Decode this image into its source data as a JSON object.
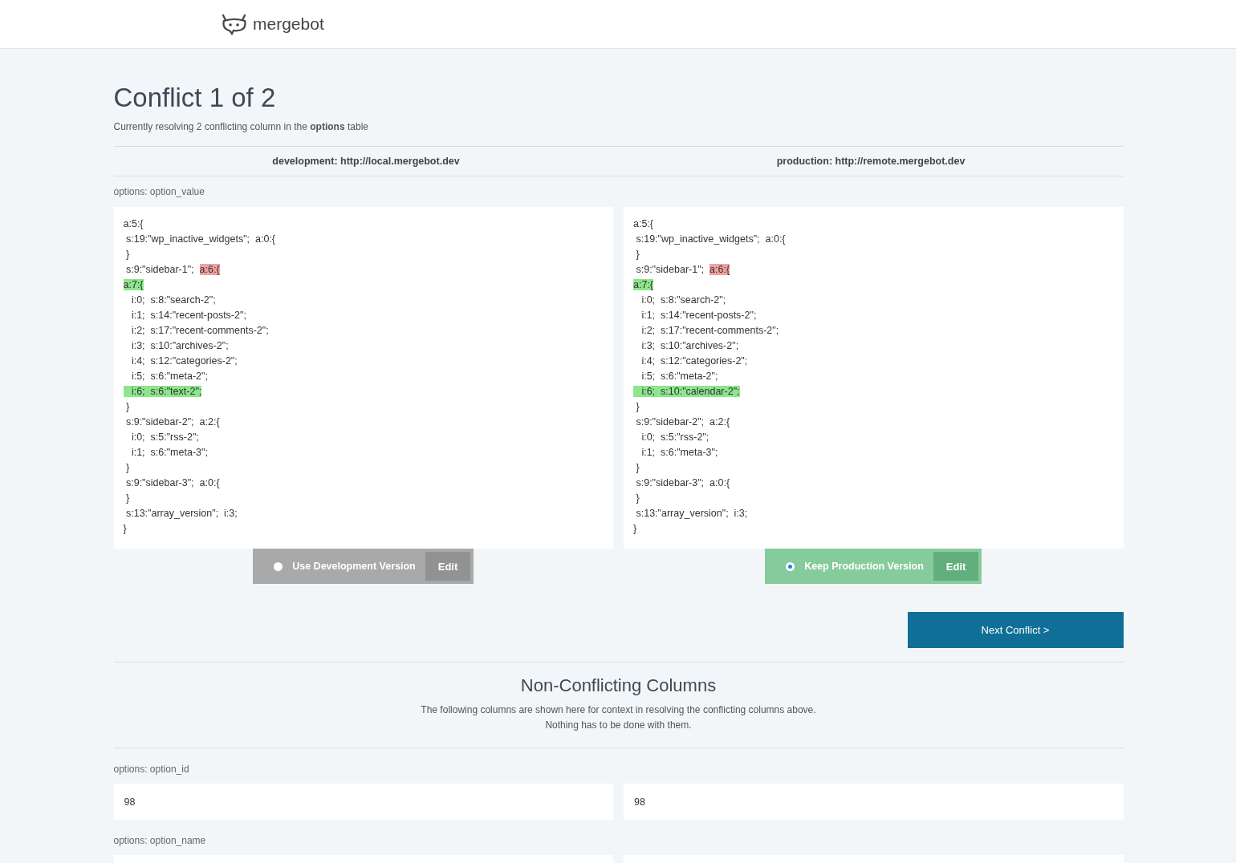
{
  "header": {
    "logo_text": "mergebot"
  },
  "title": "Conflict 1 of 2",
  "subtitle": "Currently resolving 2 conflicting column in the **options** table",
  "environments": [
    "development: http://local.mergebot.dev",
    "production: http://remote.mergebot.dev"
  ],
  "conflict": {
    "label": "options: option_value",
    "versions": [
      {
        "lines": [
          [
            {
              "text": "a:5:{",
              "kind": "plain"
            }
          ],
          [
            {
              "text": " s:19:\"wp_inactive_widgets\";  a:0:{",
              "kind": "plain"
            }
          ],
          [
            {
              "text": " }",
              "kind": "plain"
            }
          ],
          [
            {
              "text": " s:9:\"sidebar-1\";  ",
              "kind": "plain"
            },
            {
              "text": "a:6:{",
              "kind": "removed"
            }
          ],
          [
            {
              "text": "a:7:{",
              "kind": "added"
            }
          ],
          [
            {
              "text": "   i:0;  s:8:\"search-2\";",
              "kind": "plain"
            }
          ],
          [
            {
              "text": "   i:1;  s:14:\"recent-posts-2\";",
              "kind": "plain"
            }
          ],
          [
            {
              "text": "   i:2;  s:17:\"recent-comments-2\";",
              "kind": "plain"
            }
          ],
          [
            {
              "text": "   i:3;  s:10:\"archives-2\";",
              "kind": "plain"
            }
          ],
          [
            {
              "text": "   i:4;  s:12:\"categories-2\";",
              "kind": "plain"
            }
          ],
          [
            {
              "text": "   i:5;  s:6:\"meta-2\";",
              "kind": "plain"
            }
          ],
          [
            {
              "text": "   i:6;  s:6:\"text-2\";",
              "kind": "added"
            }
          ],
          [
            {
              "text": " }",
              "kind": "plain"
            }
          ],
          [
            {
              "text": " s:9:\"sidebar-2\";  a:2:{",
              "kind": "plain"
            }
          ],
          [
            {
              "text": "   i:0;  s:5:\"rss-2\";",
              "kind": "plain"
            }
          ],
          [
            {
              "text": "   i:1;  s:6:\"meta-3\";",
              "kind": "plain"
            }
          ],
          [
            {
              "text": " }",
              "kind": "plain"
            }
          ],
          [
            {
              "text": " s:9:\"sidebar-3\";  a:0:{",
              "kind": "plain"
            }
          ],
          [
            {
              "text": " }",
              "kind": "plain"
            }
          ],
          [
            {
              "text": " s:13:\"array_version\";  i:3;",
              "kind": "plain"
            }
          ],
          [
            {
              "text": "}",
              "kind": "plain"
            }
          ]
        ],
        "choice": {
          "label": "Use Development Version",
          "selected": false
        },
        "edit": "Edit"
      },
      {
        "lines": [
          [
            {
              "text": "a:5:{",
              "kind": "plain"
            }
          ],
          [
            {
              "text": " s:19:\"wp_inactive_widgets\";  a:0:{",
              "kind": "plain"
            }
          ],
          [
            {
              "text": " }",
              "kind": "plain"
            }
          ],
          [
            {
              "text": " s:9:\"sidebar-1\";  ",
              "kind": "plain"
            },
            {
              "text": "a:6:{",
              "kind": "removed"
            }
          ],
          [
            {
              "text": "a:7:{",
              "kind": "added"
            }
          ],
          [
            {
              "text": "   i:0;  s:8:\"search-2\";",
              "kind": "plain"
            }
          ],
          [
            {
              "text": "   i:1;  s:14:\"recent-posts-2\";",
              "kind": "plain"
            }
          ],
          [
            {
              "text": "   i:2;  s:17:\"recent-comments-2\";",
              "kind": "plain"
            }
          ],
          [
            {
              "text": "   i:3;  s:10:\"archives-2\";",
              "kind": "plain"
            }
          ],
          [
            {
              "text": "   i:4;  s:12:\"categories-2\";",
              "kind": "plain"
            }
          ],
          [
            {
              "text": "   i:5;  s:6:\"meta-2\";",
              "kind": "plain"
            }
          ],
          [
            {
              "text": "   i:6;  s:10:\"calendar-2\";",
              "kind": "added"
            }
          ],
          [
            {
              "text": " }",
              "kind": "plain"
            }
          ],
          [
            {
              "text": " s:9:\"sidebar-2\";  a:2:{",
              "kind": "plain"
            }
          ],
          [
            {
              "text": "   i:0;  s:5:\"rss-2\";",
              "kind": "plain"
            }
          ],
          [
            {
              "text": "   i:1;  s:6:\"meta-3\";",
              "kind": "plain"
            }
          ],
          [
            {
              "text": " }",
              "kind": "plain"
            }
          ],
          [
            {
              "text": " s:9:\"sidebar-3\";  a:0:{",
              "kind": "plain"
            }
          ],
          [
            {
              "text": " }",
              "kind": "plain"
            }
          ],
          [
            {
              "text": " s:13:\"array_version\";  i:3;",
              "kind": "plain"
            }
          ],
          [
            {
              "text": "}",
              "kind": "plain"
            }
          ]
        ],
        "choice": {
          "label": "Keep Production Version",
          "selected": true
        },
        "edit": "Edit"
      }
    ]
  },
  "next_button": "Next Conflict >",
  "non_conflicting": {
    "title": "Non-Conflicting Columns",
    "description": [
      "The following columns are shown here for context in resolving the conflicting columns above.",
      "Nothing has to be done with them."
    ],
    "columns": [
      {
        "label": "options: option_id",
        "values": [
          "98",
          "98"
        ]
      },
      {
        "label": "options: option_name"
      }
    ]
  }
}
